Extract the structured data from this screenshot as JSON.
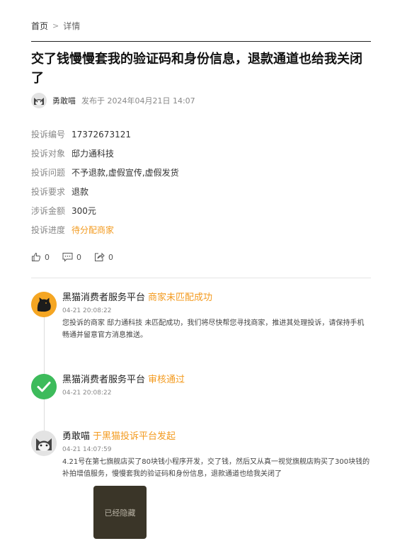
{
  "breadcrumb": {
    "home": "首页",
    "separator": ">",
    "current": "详情"
  },
  "title": "交了钱慢慢套我的验证码和身份信息，退款通道也给我关闭了",
  "author": {
    "name": "勇敢喵",
    "published": "发布于 2024年04月21日 14:07"
  },
  "info": [
    {
      "key": "投诉编号",
      "value": "17372673121"
    },
    {
      "key": "投诉对象",
      "value": "邸力通科技"
    },
    {
      "key": "投诉问题",
      "value": "不予退款,虚假宣传,虚假发货"
    },
    {
      "key": "投诉要求",
      "value": "退款"
    },
    {
      "key": "涉诉金额",
      "value": "300元"
    },
    {
      "key": "投诉进度",
      "value": "待分配商家"
    }
  ],
  "actions": {
    "like_count": "0",
    "comment_count": "0",
    "share_count": "0"
  },
  "timeline": [
    {
      "actor": "黑猫消费者服务平台",
      "status": "商家未匹配成功",
      "time": "04-21 20:08:22",
      "text": "您投诉的商家 邸力通科技 未匹配成功，我们将尽快帮您寻找商家，推进其处理投诉，请保持手机畅通并留意官方消息推送。",
      "icon": "black-cat-logo-icon"
    },
    {
      "actor": "黑猫消费者服务平台",
      "status": "审核通过",
      "time": "04-21 20:08:22",
      "icon": "check-circle-icon"
    },
    {
      "actor": "勇敢喵",
      "status": "于黑猫投诉平台发起",
      "time": "04-21 14:07:59",
      "text": "4.21号在第七旗舰店买了80块钱小程序开发，交了钱，然后又从真一视觉旗舰店购买了300块钱的补拍增值服务，慢慢套我的验证码和身份信息，退款通道也给我关闭了",
      "icon": "cat-avatar-icon",
      "attachment_label": "已经隐藏"
    }
  ],
  "colors": {
    "accent": "#f39a1e",
    "check": "#3dbb5b"
  }
}
